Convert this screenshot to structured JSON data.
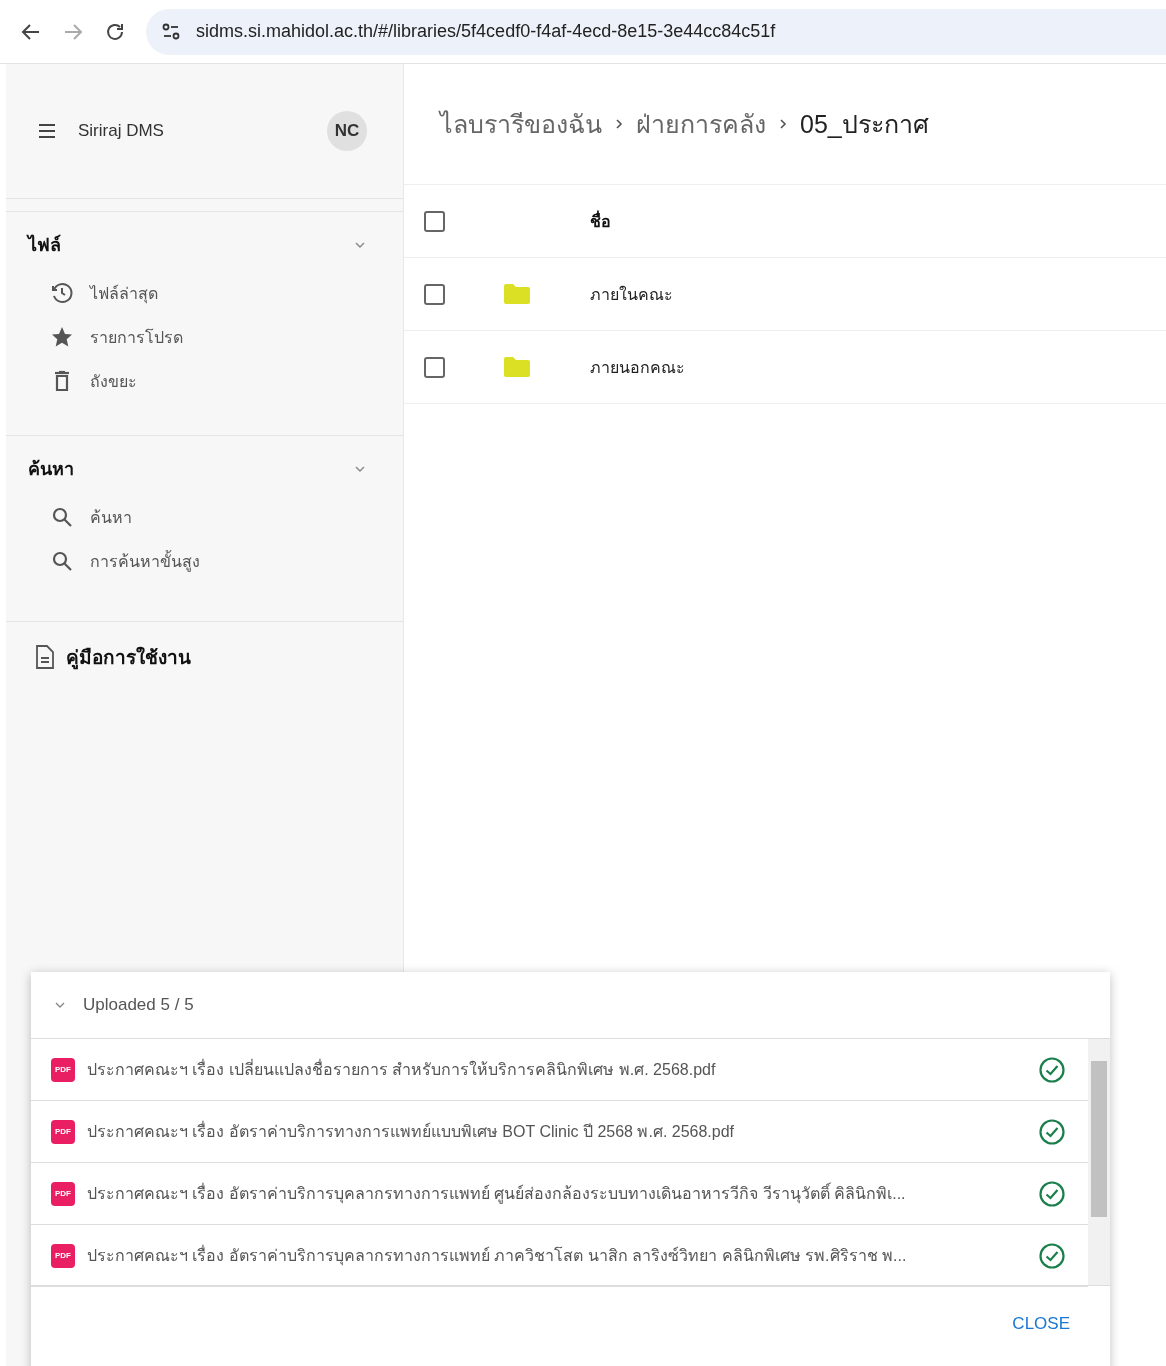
{
  "browser": {
    "url": "sidms.si.mahidol.ac.th/#/libraries/5f4cedf0-f4af-4ecd-8e15-3e44cc84c51f"
  },
  "sidebar": {
    "app_title": "Siriraj DMS",
    "avatar": "NC",
    "sections": [
      {
        "title": "ไฟล์",
        "expanded": true,
        "items": [
          {
            "label": "ไฟล์ล่าสุด"
          },
          {
            "label": "รายการโปรด"
          },
          {
            "label": "ถังขยะ"
          }
        ]
      },
      {
        "title": "ค้นหา",
        "expanded": true,
        "items": [
          {
            "label": "ค้นหา"
          },
          {
            "label": "การค้นหาขั้นสูง"
          }
        ]
      }
    ],
    "manual": "คู่มือการใช้งาน"
  },
  "breadcrumb": [
    "ไลบรารีของฉัน",
    "ฝ่ายการคลัง",
    "05_ประกาศ"
  ],
  "table": {
    "column_header": "ชื่อ",
    "header_checked": false,
    "rows": [
      {
        "name": "ภายในคณะ",
        "checked": false
      },
      {
        "name": "ภายนอกคณะ",
        "checked": false
      }
    ]
  },
  "upload_panel": {
    "title": "Uploaded 5 / 5",
    "expanded": true,
    "close": "CLOSE",
    "files": [
      {
        "badge": "PDF",
        "name": "ประกาศคณะฯ เรื่อง เปลี่ยนแปลงชื่อรายการ สำหรับการให้บริการคลินิกพิเศษ พ.ศ. 2568.pdf",
        "done": true
      },
      {
        "badge": "PDF",
        "name": "ประกาศคณะฯ เรื่อง อัตราค่าบริการทางการแพทย์แบบพิเศษ BOT Clinic ปี 2568 พ.ศ. 2568.pdf",
        "done": true
      },
      {
        "badge": "PDF",
        "name": "ประกาศคณะฯ เรื่อง อัตราค่าบริการบุคลากรทางการแพทย์ ศูนย์ส่องกล้องระบบทางเดินอาหารวีกิจ วีรานุวัตติ์ คิลินิกพิเ...",
        "done": true
      },
      {
        "badge": "PDF",
        "name": "ประกาศคณะฯ เรื่อง อัตราค่าบริการบุคลากรทางการแพทย์ ภาควิชาโสต นาสิก ลาริงซ์วิทยา คลินิกพิเศษ รพ.ศิริราช พ...",
        "done": true
      }
    ]
  }
}
